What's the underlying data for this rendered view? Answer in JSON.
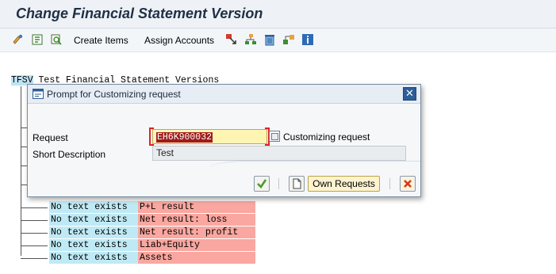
{
  "window": {
    "title": "Change Financial Statement Version"
  },
  "toolbar": {
    "icons": [
      "glasses-icon",
      "structure-icon",
      "find-icon"
    ],
    "create_items": "Create Items",
    "assign_accounts": "Assign Accounts",
    "right_icons": [
      "select-icon",
      "hierarchy-icon",
      "delete-icon",
      "reassign-icon",
      "info-icon"
    ]
  },
  "tree": {
    "root_code": "TFSV",
    "root_text": "Test Financial Statement Versions",
    "rows": [
      {
        "text": "No text exists",
        "item": "P+L result"
      },
      {
        "text": "No text exists",
        "item": "Net result: loss"
      },
      {
        "text": "No text exists",
        "item": "Net result: profit"
      },
      {
        "text": "No text exists",
        "item": "Liab+Equity"
      },
      {
        "text": "No text exists",
        "item": "Assets"
      }
    ]
  },
  "dialog": {
    "title": "Prompt for Customizing request",
    "request_label": "Request",
    "request_value": "EH6K900032",
    "request_type": "Customizing request",
    "short_desc_label": "Short Description",
    "short_desc_value": "Test",
    "own_requests": "Own Requests",
    "colors": {
      "highlight": "#a01a1a",
      "required": "#e02020"
    }
  }
}
